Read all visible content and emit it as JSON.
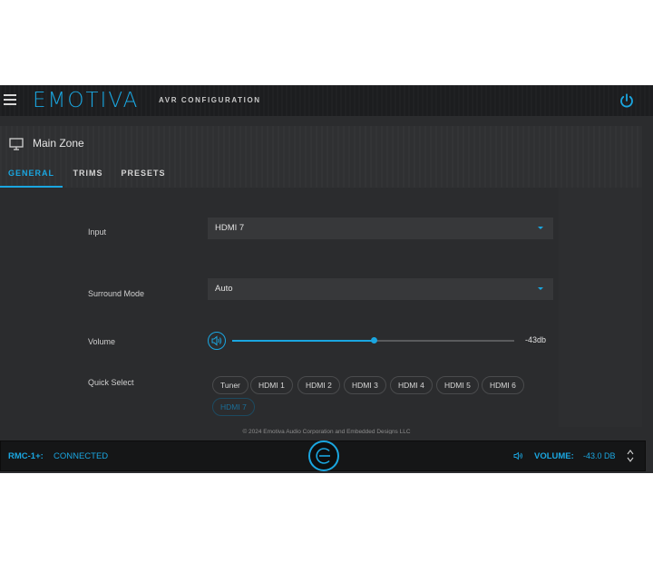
{
  "header": {
    "logo": "EMOTIVA",
    "subtitle": "AVR CONFIGURATION",
    "menu_icon": "hamburger-icon",
    "power_icon": "power-icon"
  },
  "zone": {
    "title": "Main Zone",
    "icon": "monitor-icon",
    "tabs": [
      {
        "label": "GENERAL",
        "active": true
      },
      {
        "label": "TRIMS",
        "active": false
      },
      {
        "label": "PRESETS",
        "active": false
      }
    ]
  },
  "form": {
    "input_label": "Input",
    "input_value": "HDMI 7",
    "surround_label": "Surround Mode",
    "surround_value": "Auto",
    "volume_label": "Volume",
    "volume_readout": "-43db",
    "volume_fraction": 0.5,
    "quick_label": "Quick Select",
    "quick_options": [
      "Tuner",
      "HDMI 1",
      "HDMI 2",
      "HDMI 3",
      "HDMI 4",
      "HDMI 5",
      "HDMI 6",
      "HDMI 7"
    ],
    "quick_selected": "HDMI 7"
  },
  "footer": {
    "copyright": "© 2024 Emotiva Audio Corporation and Embedded Designs LLC"
  },
  "status": {
    "rmc_label": "RMC-1+:",
    "rmc_status": "CONNECTED",
    "volume_label": "VOLUME:",
    "volume_value": "-43.0 DB"
  },
  "colors": {
    "accent": "#1aa6e0",
    "background": "#2b2c2e",
    "header": "#1c1d1f"
  }
}
